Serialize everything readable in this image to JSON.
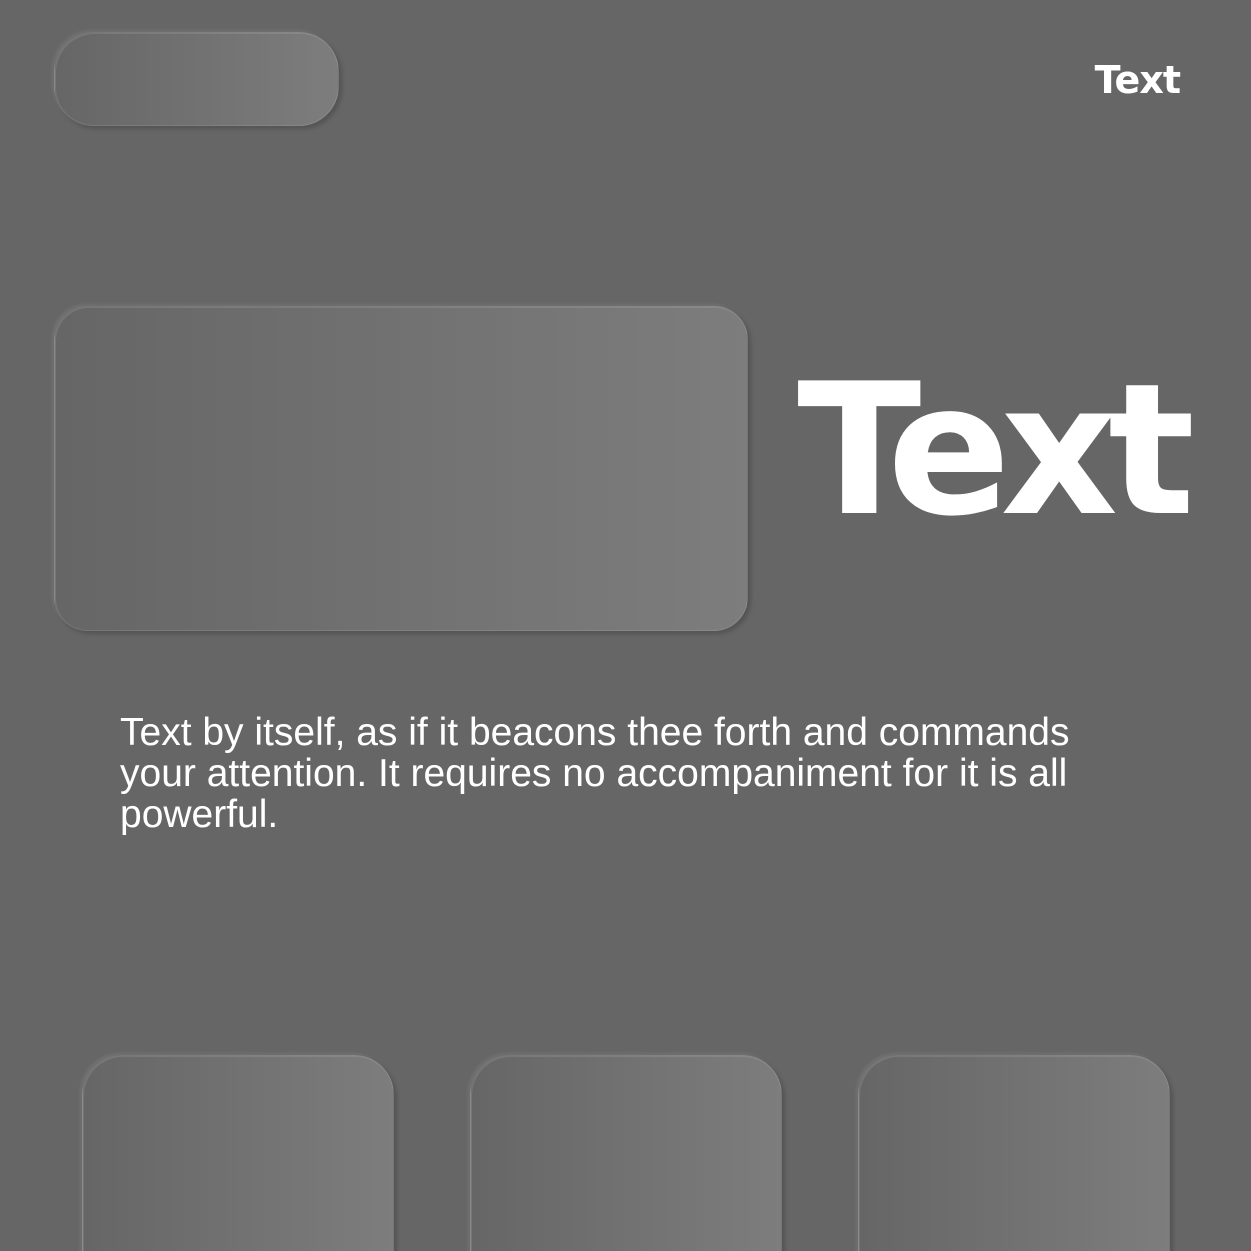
{
  "header": {
    "nav_text": "Text"
  },
  "hero": {
    "title": "Text"
  },
  "main": {
    "paragraph": "Text by itself, as if it beacons thee forth and commands your attention. It requires no accompaniment for it is all powerful."
  },
  "colors": {
    "background": "#666666",
    "card_gradient_start": "#666666",
    "card_gradient_end": "#7d7d7d",
    "text": "#ffffff"
  }
}
